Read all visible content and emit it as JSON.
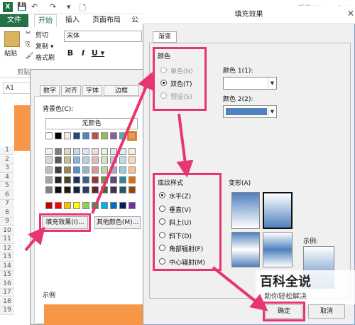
{
  "excel": {
    "title": "新建 Microsoft O",
    "tabs": [
      "文件",
      "开始",
      "插入",
      "页面布局",
      "公"
    ],
    "ribbon": {
      "paste": "粘贴",
      "cut": "剪切",
      "copy": "复制 ▾",
      "format_painter": "格式刷",
      "clipboard": "剪贴",
      "font": "宋体",
      "bold": "B",
      "italic": "I",
      "underline": "U ▾"
    },
    "name_box": "A1",
    "rows": [
      "1",
      "2",
      "3",
      "4",
      "5",
      "6",
      "7",
      "8",
      "9",
      "10",
      "11",
      "12",
      "13",
      "14",
      "15",
      "16",
      "17",
      "18",
      "19"
    ]
  },
  "format_cells": {
    "tabs": [
      "数字",
      "对齐",
      "字体",
      "边框"
    ],
    "bg_color_label": "背景色(C):",
    "no_color": "无颜色",
    "fill_effects_button": "填充效果(I)...",
    "more_colors_button": "其他颜色(M)...",
    "sample_label": "示例",
    "sample_color": "#f79646"
  },
  "fill_effects": {
    "title": "填充效果",
    "tab_gradient": "渐变",
    "colors_group": "颜色",
    "color_options": [
      {
        "label": "单色(N)",
        "selected": false,
        "disabled": true
      },
      {
        "label": "双色(T)",
        "selected": true,
        "disabled": false
      },
      {
        "label": "预设(S)",
        "selected": false,
        "disabled": true
      }
    ],
    "color1_label": "颜色 1(1):",
    "color2_label": "颜色 2(2):",
    "color1_value": "#ffffff",
    "color2_value": "#4f81bd",
    "shading_group": "底纹样式",
    "shading_options": [
      {
        "label": "水平(Z)",
        "selected": true
      },
      {
        "label": "垂直(V)",
        "selected": false
      },
      {
        "label": "斜上(U)",
        "selected": false
      },
      {
        "label": "斜下(D)",
        "selected": false
      },
      {
        "label": "角部辐射(F)",
        "selected": false
      },
      {
        "label": "中心辐射(M)",
        "selected": false
      }
    ],
    "variants_label": "变形(A)",
    "sample_label": "示例:",
    "ok_button": "确定",
    "cancel_button": "取消"
  },
  "watermark": {
    "title": "百科全说",
    "subtitle": "助你轻松解决"
  },
  "accent": "#e8356f"
}
